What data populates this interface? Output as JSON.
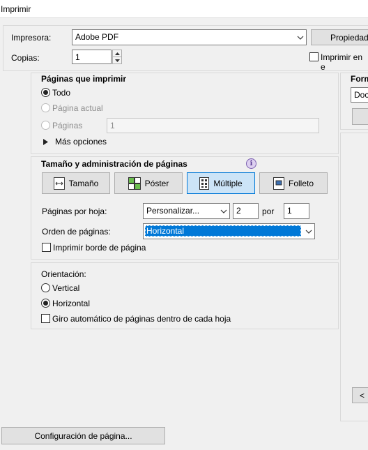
{
  "window": {
    "title": "Imprimir"
  },
  "printer": {
    "label": "Impresora:",
    "value": "Adobe PDF",
    "properties_button": "Propiedad",
    "copies_label": "Copias:",
    "copies_value": "1",
    "print_to_file_label": "Imprimir en e"
  },
  "pages_to_print": {
    "title": "Páginas que imprimir",
    "all_label": "Todo",
    "current_label": "Página actual",
    "pages_label": "Páginas",
    "pages_value": "1",
    "more_options_label": "Más opciones"
  },
  "sizing": {
    "title": "Tamaño y administración de páginas",
    "info_icon": "info-icon",
    "tabs": [
      {
        "label": "Tamaño",
        "icon": "size-icon"
      },
      {
        "label": "Póster",
        "icon": "poster-icon"
      },
      {
        "label": "Múltiple",
        "icon": "multiple-icon"
      },
      {
        "label": "Folleto",
        "icon": "booklet-icon"
      }
    ],
    "pages_per_sheet_label": "Páginas por hoja:",
    "pages_per_sheet_value": "Personalizar...",
    "cols_value": "2",
    "by_label": "por",
    "rows_value": "1",
    "page_order_label": "Orden de páginas:",
    "page_order_value": "Horizontal",
    "print_border_label": "Imprimir borde de página"
  },
  "orientation": {
    "title": "Orientación:",
    "vertical_label": "Vertical",
    "horizontal_label": "Horizontal",
    "auto_rotate_label": "Giro automático de páginas dentro de cada hoja"
  },
  "comments": {
    "title": "Form",
    "value": "Doc"
  },
  "preview": {
    "prev_button": "<"
  },
  "footer": {
    "page_setup_button": "Configuración de página..."
  },
  "colors": {
    "accent": "#0078d7",
    "selection": "#0078d7",
    "active_tile": "#cce4f7"
  }
}
